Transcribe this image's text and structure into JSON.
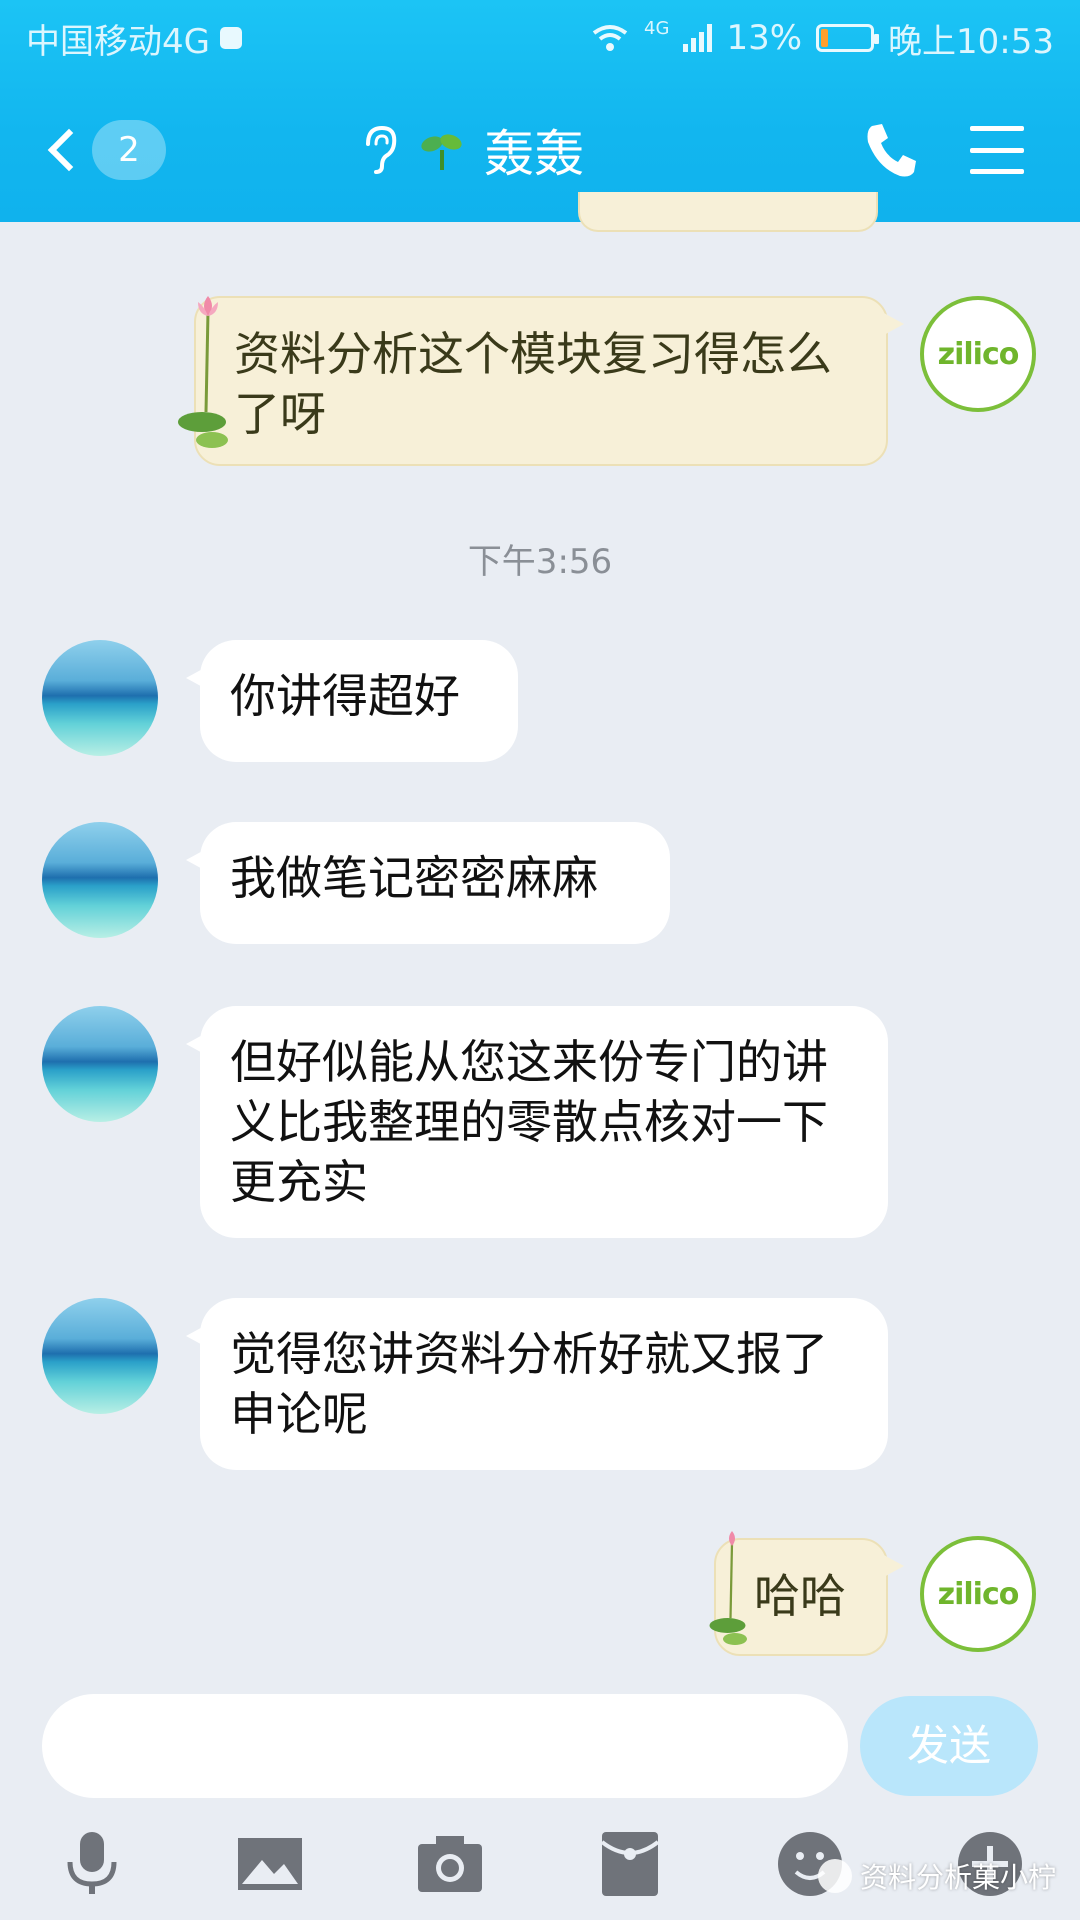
{
  "status_bar": {
    "carrier": "中国移动4G",
    "network_badge": "4G",
    "battery": "13%",
    "battery_level": 0.13,
    "time": "晚上10:53"
  },
  "header": {
    "unread_count": "2",
    "title": "轰轰",
    "icons": [
      "back-chevron-icon",
      "ear-icon",
      "sprout-icon",
      "phone-icon",
      "menu-icon"
    ]
  },
  "messages": [
    {
      "side": "out",
      "text": "资料分析这个模块复习得怎么了呀"
    },
    {
      "side": "in",
      "text": "你讲得超好"
    },
    {
      "side": "in",
      "text": "我做笔记密密麻麻"
    },
    {
      "side": "in",
      "text": "但好似能从您这来份专门的讲义比我整理的零散点核对一下更充实"
    },
    {
      "side": "in",
      "text": "觉得您讲资料分析好就又报了申论呢"
    },
    {
      "side": "out",
      "text": "哈哈"
    }
  ],
  "timestamp": "下午3:56",
  "avatar_logo_text": "zilico",
  "input": {
    "value": "",
    "send_label": "发送"
  },
  "toolbar_icons": [
    "microphone-icon",
    "image-icon",
    "camera-icon",
    "red-packet-icon",
    "emoji-icon",
    "plus-icon"
  ],
  "watermark": "资料分析菓小柠",
  "colors": {
    "header": "#12b6ef",
    "bubble_out": "#f7f0d8",
    "bubble_in": "#ffffff",
    "send_button": "#b9e6fb"
  }
}
